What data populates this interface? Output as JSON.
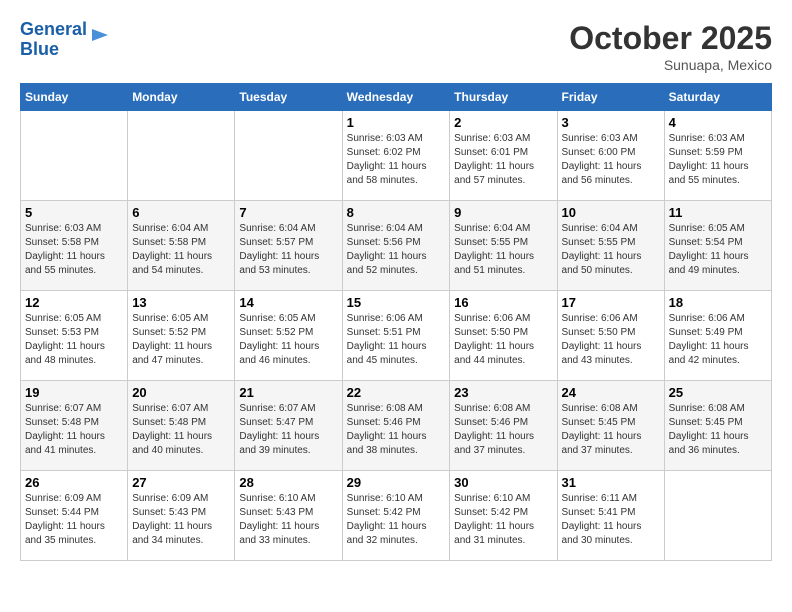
{
  "logo": {
    "line1": "General",
    "line2": "Blue"
  },
  "header": {
    "month": "October 2025",
    "location": "Sunuapa, Mexico"
  },
  "weekdays": [
    "Sunday",
    "Monday",
    "Tuesday",
    "Wednesday",
    "Thursday",
    "Friday",
    "Saturday"
  ],
  "weeks": [
    [
      {
        "day": "",
        "sunrise": "",
        "sunset": "",
        "daylight": ""
      },
      {
        "day": "",
        "sunrise": "",
        "sunset": "",
        "daylight": ""
      },
      {
        "day": "",
        "sunrise": "",
        "sunset": "",
        "daylight": ""
      },
      {
        "day": "1",
        "sunrise": "6:03 AM",
        "sunset": "6:02 PM",
        "daylight": "11 hours and 58 minutes."
      },
      {
        "day": "2",
        "sunrise": "6:03 AM",
        "sunset": "6:01 PM",
        "daylight": "11 hours and 57 minutes."
      },
      {
        "day": "3",
        "sunrise": "6:03 AM",
        "sunset": "6:00 PM",
        "daylight": "11 hours and 56 minutes."
      },
      {
        "day": "4",
        "sunrise": "6:03 AM",
        "sunset": "5:59 PM",
        "daylight": "11 hours and 55 minutes."
      }
    ],
    [
      {
        "day": "5",
        "sunrise": "6:03 AM",
        "sunset": "5:58 PM",
        "daylight": "11 hours and 55 minutes."
      },
      {
        "day": "6",
        "sunrise": "6:04 AM",
        "sunset": "5:58 PM",
        "daylight": "11 hours and 54 minutes."
      },
      {
        "day": "7",
        "sunrise": "6:04 AM",
        "sunset": "5:57 PM",
        "daylight": "11 hours and 53 minutes."
      },
      {
        "day": "8",
        "sunrise": "6:04 AM",
        "sunset": "5:56 PM",
        "daylight": "11 hours and 52 minutes."
      },
      {
        "day": "9",
        "sunrise": "6:04 AM",
        "sunset": "5:55 PM",
        "daylight": "11 hours and 51 minutes."
      },
      {
        "day": "10",
        "sunrise": "6:04 AM",
        "sunset": "5:55 PM",
        "daylight": "11 hours and 50 minutes."
      },
      {
        "day": "11",
        "sunrise": "6:05 AM",
        "sunset": "5:54 PM",
        "daylight": "11 hours and 49 minutes."
      }
    ],
    [
      {
        "day": "12",
        "sunrise": "6:05 AM",
        "sunset": "5:53 PM",
        "daylight": "11 hours and 48 minutes."
      },
      {
        "day": "13",
        "sunrise": "6:05 AM",
        "sunset": "5:52 PM",
        "daylight": "11 hours and 47 minutes."
      },
      {
        "day": "14",
        "sunrise": "6:05 AM",
        "sunset": "5:52 PM",
        "daylight": "11 hours and 46 minutes."
      },
      {
        "day": "15",
        "sunrise": "6:06 AM",
        "sunset": "5:51 PM",
        "daylight": "11 hours and 45 minutes."
      },
      {
        "day": "16",
        "sunrise": "6:06 AM",
        "sunset": "5:50 PM",
        "daylight": "11 hours and 44 minutes."
      },
      {
        "day": "17",
        "sunrise": "6:06 AM",
        "sunset": "5:50 PM",
        "daylight": "11 hours and 43 minutes."
      },
      {
        "day": "18",
        "sunrise": "6:06 AM",
        "sunset": "5:49 PM",
        "daylight": "11 hours and 42 minutes."
      }
    ],
    [
      {
        "day": "19",
        "sunrise": "6:07 AM",
        "sunset": "5:48 PM",
        "daylight": "11 hours and 41 minutes."
      },
      {
        "day": "20",
        "sunrise": "6:07 AM",
        "sunset": "5:48 PM",
        "daylight": "11 hours and 40 minutes."
      },
      {
        "day": "21",
        "sunrise": "6:07 AM",
        "sunset": "5:47 PM",
        "daylight": "11 hours and 39 minutes."
      },
      {
        "day": "22",
        "sunrise": "6:08 AM",
        "sunset": "5:46 PM",
        "daylight": "11 hours and 38 minutes."
      },
      {
        "day": "23",
        "sunrise": "6:08 AM",
        "sunset": "5:46 PM",
        "daylight": "11 hours and 37 minutes."
      },
      {
        "day": "24",
        "sunrise": "6:08 AM",
        "sunset": "5:45 PM",
        "daylight": "11 hours and 37 minutes."
      },
      {
        "day": "25",
        "sunrise": "6:08 AM",
        "sunset": "5:45 PM",
        "daylight": "11 hours and 36 minutes."
      }
    ],
    [
      {
        "day": "26",
        "sunrise": "6:09 AM",
        "sunset": "5:44 PM",
        "daylight": "11 hours and 35 minutes."
      },
      {
        "day": "27",
        "sunrise": "6:09 AM",
        "sunset": "5:43 PM",
        "daylight": "11 hours and 34 minutes."
      },
      {
        "day": "28",
        "sunrise": "6:10 AM",
        "sunset": "5:43 PM",
        "daylight": "11 hours and 33 minutes."
      },
      {
        "day": "29",
        "sunrise": "6:10 AM",
        "sunset": "5:42 PM",
        "daylight": "11 hours and 32 minutes."
      },
      {
        "day": "30",
        "sunrise": "6:10 AM",
        "sunset": "5:42 PM",
        "daylight": "11 hours and 31 minutes."
      },
      {
        "day": "31",
        "sunrise": "6:11 AM",
        "sunset": "5:41 PM",
        "daylight": "11 hours and 30 minutes."
      },
      {
        "day": "",
        "sunrise": "",
        "sunset": "",
        "daylight": ""
      }
    ]
  ],
  "labels": {
    "sunrise": "Sunrise:",
    "sunset": "Sunset:",
    "daylight": "Daylight hours"
  }
}
